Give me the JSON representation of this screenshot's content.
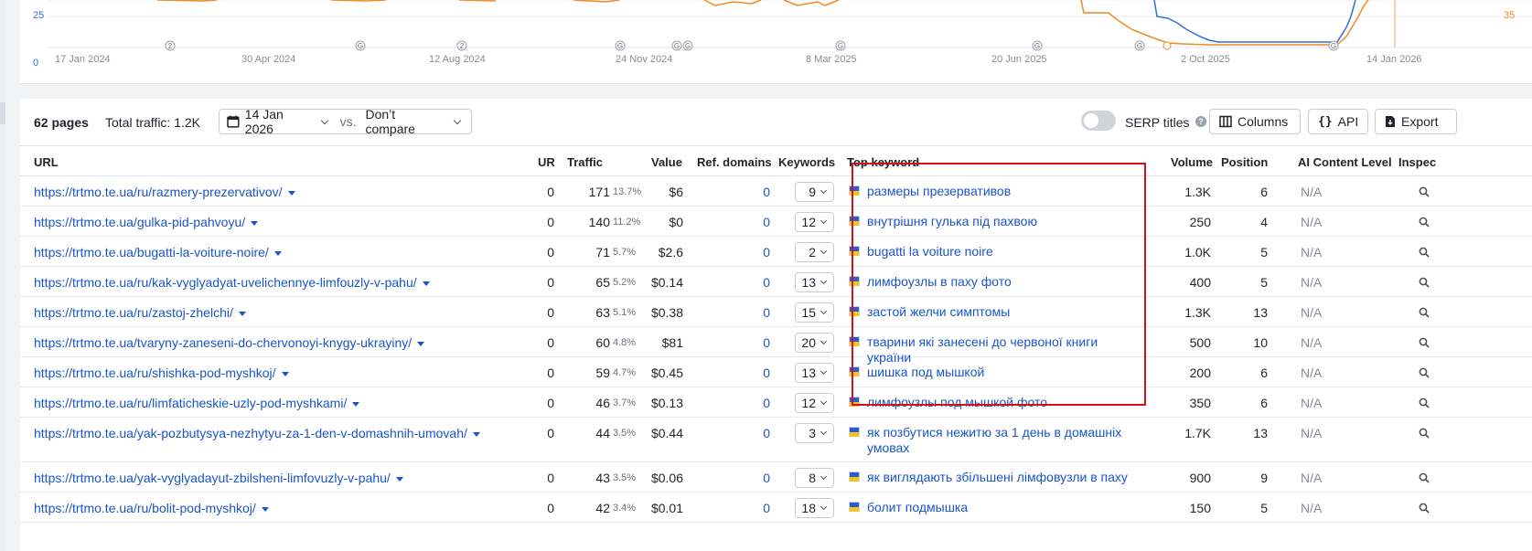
{
  "chart": {
    "y_labels_left": [
      "25",
      "0"
    ],
    "y_label_right": "35",
    "x_labels": [
      "17 Jan 2024",
      "30 Apr 2024",
      "12 Aug 2024",
      "24 Nov 2024",
      "8 Mar 2025",
      "20 Jun 2025",
      "2 Oct 2025",
      "14 Jan 2026"
    ],
    "markers": [
      "2",
      "G",
      "2",
      "G",
      "G",
      "G",
      "G",
      "G",
      "G",
      "G"
    ],
    "colors": {
      "blue": "#2f6fd6",
      "orange": "#f08a24"
    }
  },
  "toolbar": {
    "pages_count": "62 pages",
    "total_traffic": "Total traffic: 1.2K",
    "date": "14 Jan 2026",
    "vs": "vs.",
    "compare": "Don’t compare",
    "serp_titles": "SERP titles",
    "help": "?",
    "columns": "Columns",
    "api": "API",
    "export": "Export"
  },
  "table": {
    "headers": {
      "url": "URL",
      "ur": "UR",
      "traffic": "Traffic",
      "value": "Value",
      "ref_domains": "Ref. domains",
      "keywords": "Keywords",
      "top_keyword": "Top keyword",
      "volume": "Volume",
      "position": "Position",
      "ai_content": "AI Content Level",
      "inspect": "Inspec"
    },
    "rows": [
      {
        "url": "https://trtmo.te.ua/ru/razmery-prezervativov/",
        "ur": "0",
        "traffic": "171",
        "pct": "13.7%",
        "value": "$6",
        "ref": "0",
        "kw": "9",
        "top": "размеры презервативов",
        "vol": "1.3K",
        "pos": "6",
        "ai": "N/A"
      },
      {
        "url": "https://trtmo.te.ua/gulka-pid-pahvoyu/",
        "ur": "0",
        "traffic": "140",
        "pct": "11.2%",
        "value": "$0",
        "ref": "0",
        "kw": "12",
        "top": "внутрішня гулька під пахвою",
        "vol": "250",
        "pos": "4",
        "ai": "N/A"
      },
      {
        "url": "https://trtmo.te.ua/bugatti-la-voiture-noire/",
        "ur": "0",
        "traffic": "71",
        "pct": "5.7%",
        "value": "$2.6",
        "ref": "0",
        "kw": "2",
        "top": "bugatti la voiture noire",
        "vol": "1.0K",
        "pos": "5",
        "ai": "N/A"
      },
      {
        "url": "https://trtmo.te.ua/ru/kak-vyglyadyat-uvelichennye-limfouzly-v-pahu/",
        "ur": "0",
        "traffic": "65",
        "pct": "5.2%",
        "value": "$0.14",
        "ref": "0",
        "kw": "13",
        "top": "лимфоузлы в паху фото",
        "vol": "400",
        "pos": "5",
        "ai": "N/A"
      },
      {
        "url": "https://trtmo.te.ua/ru/zastoj-zhelchi/",
        "ur": "0",
        "traffic": "63",
        "pct": "5.1%",
        "value": "$0.38",
        "ref": "0",
        "kw": "15",
        "top": "застой желчи симптомы",
        "vol": "1.3K",
        "pos": "13",
        "ai": "N/A"
      },
      {
        "url": "https://trtmo.te.ua/tvaryny-zaneseni-do-chervonoyi-knygy-ukrayiny/",
        "ur": "0",
        "traffic": "60",
        "pct": "4.8%",
        "value": "$81",
        "ref": "0",
        "kw": "20",
        "top": "тварини які занесені до червоної книги україни",
        "vol": "500",
        "pos": "10",
        "ai": "N/A"
      },
      {
        "url": "https://trtmo.te.ua/ru/shishka-pod-myshkoj/",
        "ur": "0",
        "traffic": "59",
        "pct": "4.7%",
        "value": "$0.45",
        "ref": "0",
        "kw": "13",
        "top": "шишка под мышкой",
        "vol": "200",
        "pos": "6",
        "ai": "N/A"
      },
      {
        "url": "https://trtmo.te.ua/ru/limfaticheskie-uzly-pod-myshkami/",
        "ur": "0",
        "traffic": "46",
        "pct": "3.7%",
        "value": "$0.13",
        "ref": "0",
        "kw": "12",
        "top": "лимфоузлы под мышкой фото",
        "vol": "350",
        "pos": "6",
        "ai": "N/A"
      },
      {
        "url": "https://trtmo.te.ua/yak-pozbutysya-nezhytyu-za-1-den-v-domashnih-umovah/",
        "ur": "0",
        "traffic": "44",
        "pct": "3.5%",
        "value": "$0.44",
        "ref": "0",
        "kw": "3",
        "top": "як позбутися нежитю за 1 день в домашніх умовах",
        "vol": "1.7K",
        "pos": "13",
        "ai": "N/A"
      },
      {
        "url": "https://trtmo.te.ua/yak-vyglyadayut-zbilsheni-limfovuzly-v-pahu/",
        "ur": "0",
        "traffic": "43",
        "pct": "3.5%",
        "value": "$0.06",
        "ref": "0",
        "kw": "8",
        "top": "як виглядають збільшені лімфовузли в паху",
        "vol": "900",
        "pos": "9",
        "ai": "N/A"
      },
      {
        "url": "https://trtmo.te.ua/ru/bolit-pod-myshkoj/",
        "ur": "0",
        "traffic": "42",
        "pct": "3.4%",
        "value": "$0.01",
        "ref": "0",
        "kw": "18",
        "top": "болит подмышка",
        "vol": "150",
        "pos": "5",
        "ai": "N/A"
      }
    ]
  }
}
